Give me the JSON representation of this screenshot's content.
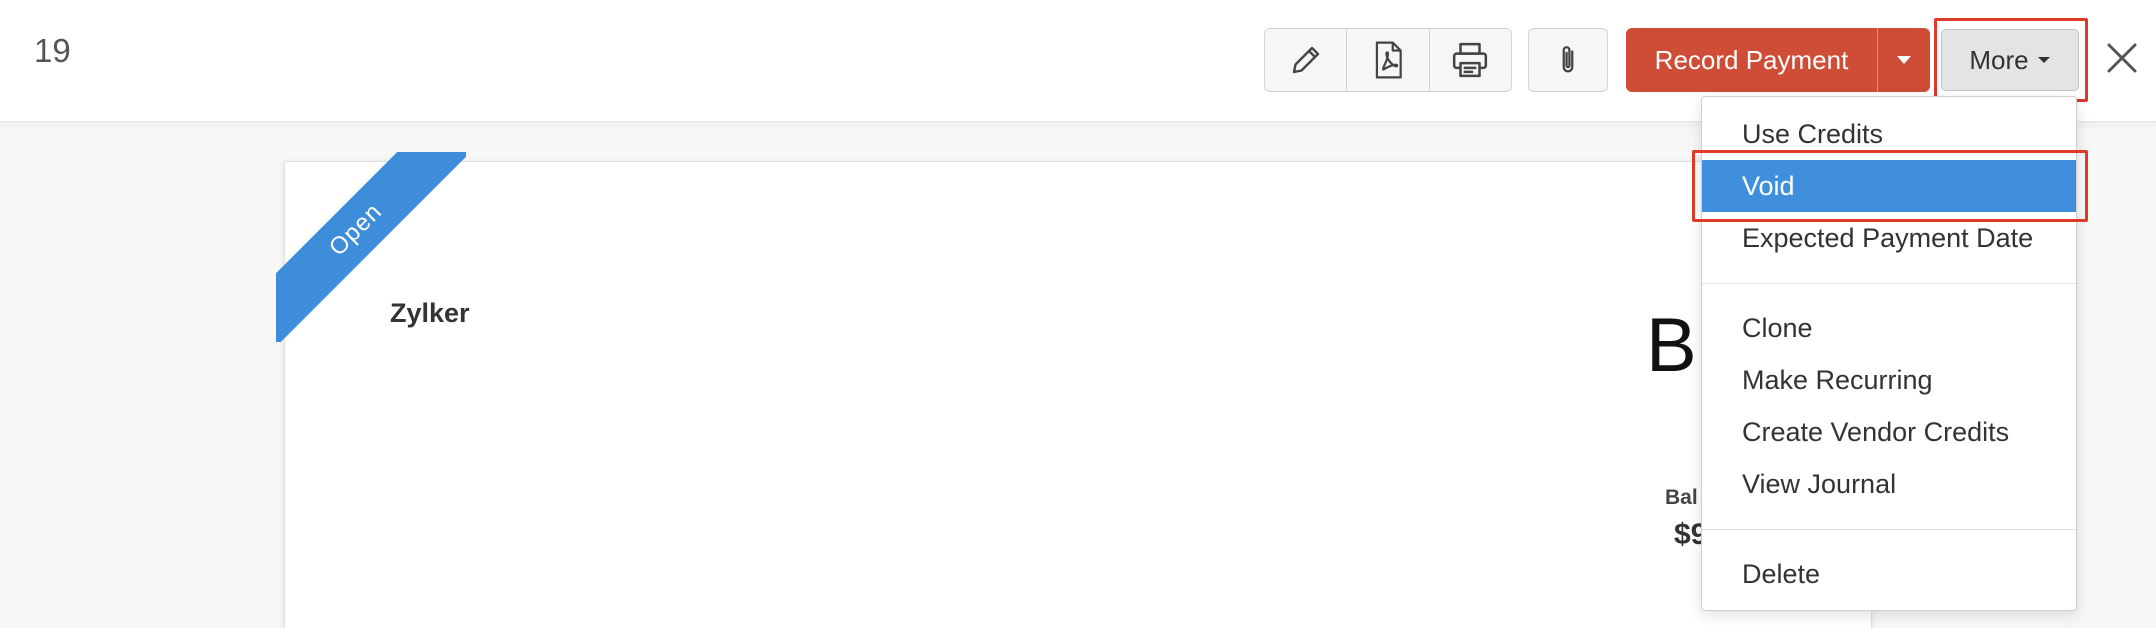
{
  "header": {
    "bill_number": "19",
    "icons": [
      "pencil-icon",
      "pdf-icon",
      "printer-icon",
      "paperclip-icon",
      "close-icon"
    ],
    "record_payment_label": "Record Payment",
    "more_label": "More"
  },
  "bill": {
    "status_ribbon": "Open",
    "vendor_name": "Zylker",
    "title_partial": "B",
    "balance_label_partial": "Bal",
    "balance_amount_partial": "$9"
  },
  "more_menu": {
    "items": [
      {
        "label": "Use Credits"
      },
      {
        "label": "Void"
      },
      {
        "label": "Expected Payment Date"
      },
      {
        "label": "Clone"
      },
      {
        "label": "Make Recurring"
      },
      {
        "label": "Create Vendor Credits"
      },
      {
        "label": "View Journal"
      },
      {
        "label": "Delete"
      }
    ],
    "highlighted_item": "Void"
  },
  "colors": {
    "record_payment": "#cf4d37",
    "menu_active": "#408fdc",
    "ribbon": "#3e8ddb",
    "highlight_outline": "#e0392a"
  }
}
